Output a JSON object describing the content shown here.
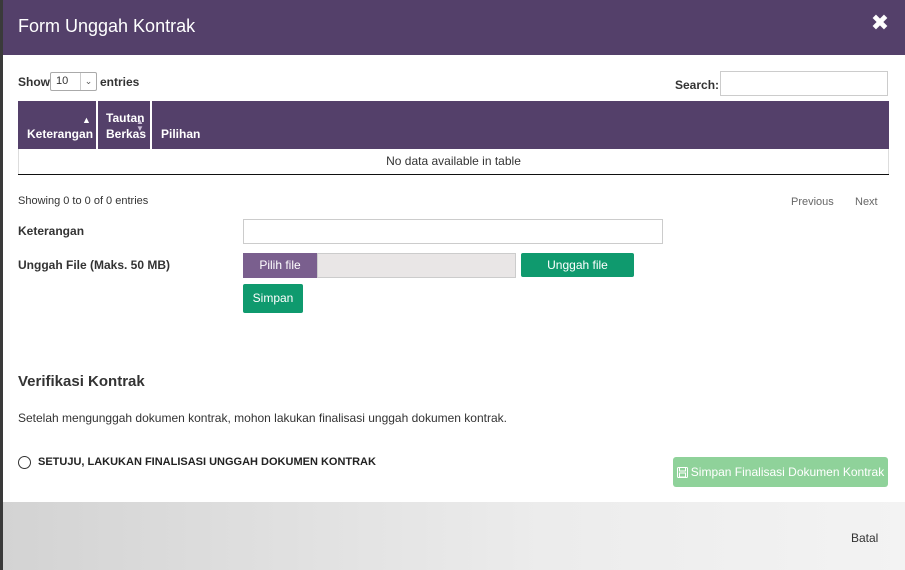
{
  "modal": {
    "title": "Form Unggah Kontrak",
    "close_icon": "close-icon"
  },
  "table_controls": {
    "show_label": "Show",
    "entries_value": "10",
    "entries_label": "entries",
    "search_label": "Search:",
    "search_value": ""
  },
  "table": {
    "columns": [
      {
        "label": "Keterangan",
        "sort": "ascending"
      },
      {
        "label_line1": "Tautan",
        "label_line2": "Berkas",
        "sort": "both"
      },
      {
        "label": "Pilihan"
      }
    ],
    "empty_text": "No data available in table",
    "info": "Showing 0 to 0 of 0 entries",
    "previous": "Previous",
    "next": "Next"
  },
  "form": {
    "keterangan_label": "Keterangan",
    "keterangan_value": "",
    "file_label": "Unggah File (Maks. 50 MB)",
    "pick_file_button": "Pilih file",
    "upload_button": "Unggah file",
    "save_button": "Simpan"
  },
  "verification": {
    "title": "Verifikasi Kontrak",
    "description": "Setelah mengunggah dokumen kontrak, mohon lakukan finalisasi unggah dokumen kontrak.",
    "agree_label": "SETUJU, LAKUKAN FINALISASI UNGGAH DOKUMEN KONTRAK",
    "final_button": "Simpan Finalisasi Dokumen Kontrak",
    "final_button_icon": "save-icon"
  },
  "footer": {
    "cancel": "Batal"
  },
  "colors": {
    "header": "#54406a",
    "primary_green": "#0f9a6e",
    "disabled_green": "#8fd29a",
    "pick_button": "#7a5f8e"
  }
}
